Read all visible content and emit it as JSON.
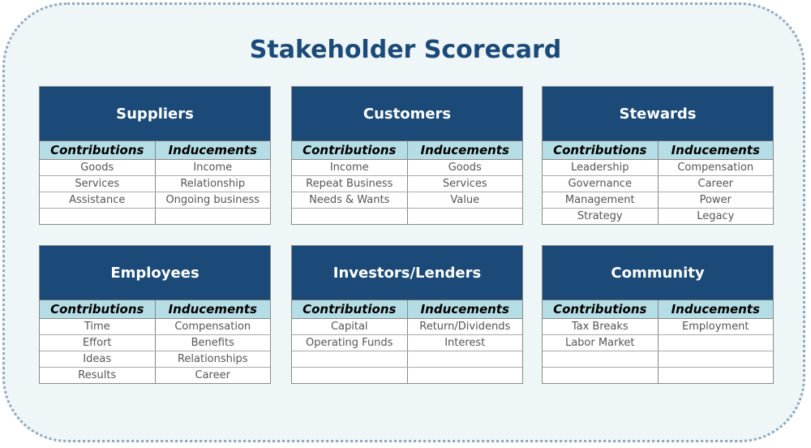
{
  "title": "Stakeholder Scorecard",
  "column_headers": {
    "contributions": "Contributions",
    "inducements": "Inducements"
  },
  "cards": [
    {
      "name": "Suppliers",
      "rows": [
        [
          "Goods",
          "Income"
        ],
        [
          "Services",
          "Relationship"
        ],
        [
          "Assistance",
          "Ongoing business"
        ],
        [
          "",
          ""
        ]
      ]
    },
    {
      "name": "Customers",
      "rows": [
        [
          "Income",
          "Goods"
        ],
        [
          "Repeat Business",
          "Services"
        ],
        [
          "Needs & Wants",
          "Value"
        ],
        [
          "",
          ""
        ]
      ]
    },
    {
      "name": "Stewards",
      "rows": [
        [
          "Leadership",
          "Compensation"
        ],
        [
          "Governance",
          "Career"
        ],
        [
          "Management",
          "Power"
        ],
        [
          "Strategy",
          "Legacy"
        ]
      ]
    },
    {
      "name": "Employees",
      "rows": [
        [
          "Time",
          "Compensation"
        ],
        [
          "Effort",
          "Benefits"
        ],
        [
          "Ideas",
          "Relationships"
        ],
        [
          "Results",
          "Career"
        ]
      ]
    },
    {
      "name": "Investors/Lenders",
      "rows": [
        [
          "Capital",
          "Return/Dividends"
        ],
        [
          "Operating Funds",
          "Interest"
        ],
        [
          "",
          ""
        ],
        [
          "",
          ""
        ]
      ]
    },
    {
      "name": "Community",
      "rows": [
        [
          "Tax Breaks",
          "Employment"
        ],
        [
          "Labor Market",
          ""
        ],
        [
          "",
          ""
        ],
        [
          "",
          ""
        ]
      ]
    }
  ]
}
